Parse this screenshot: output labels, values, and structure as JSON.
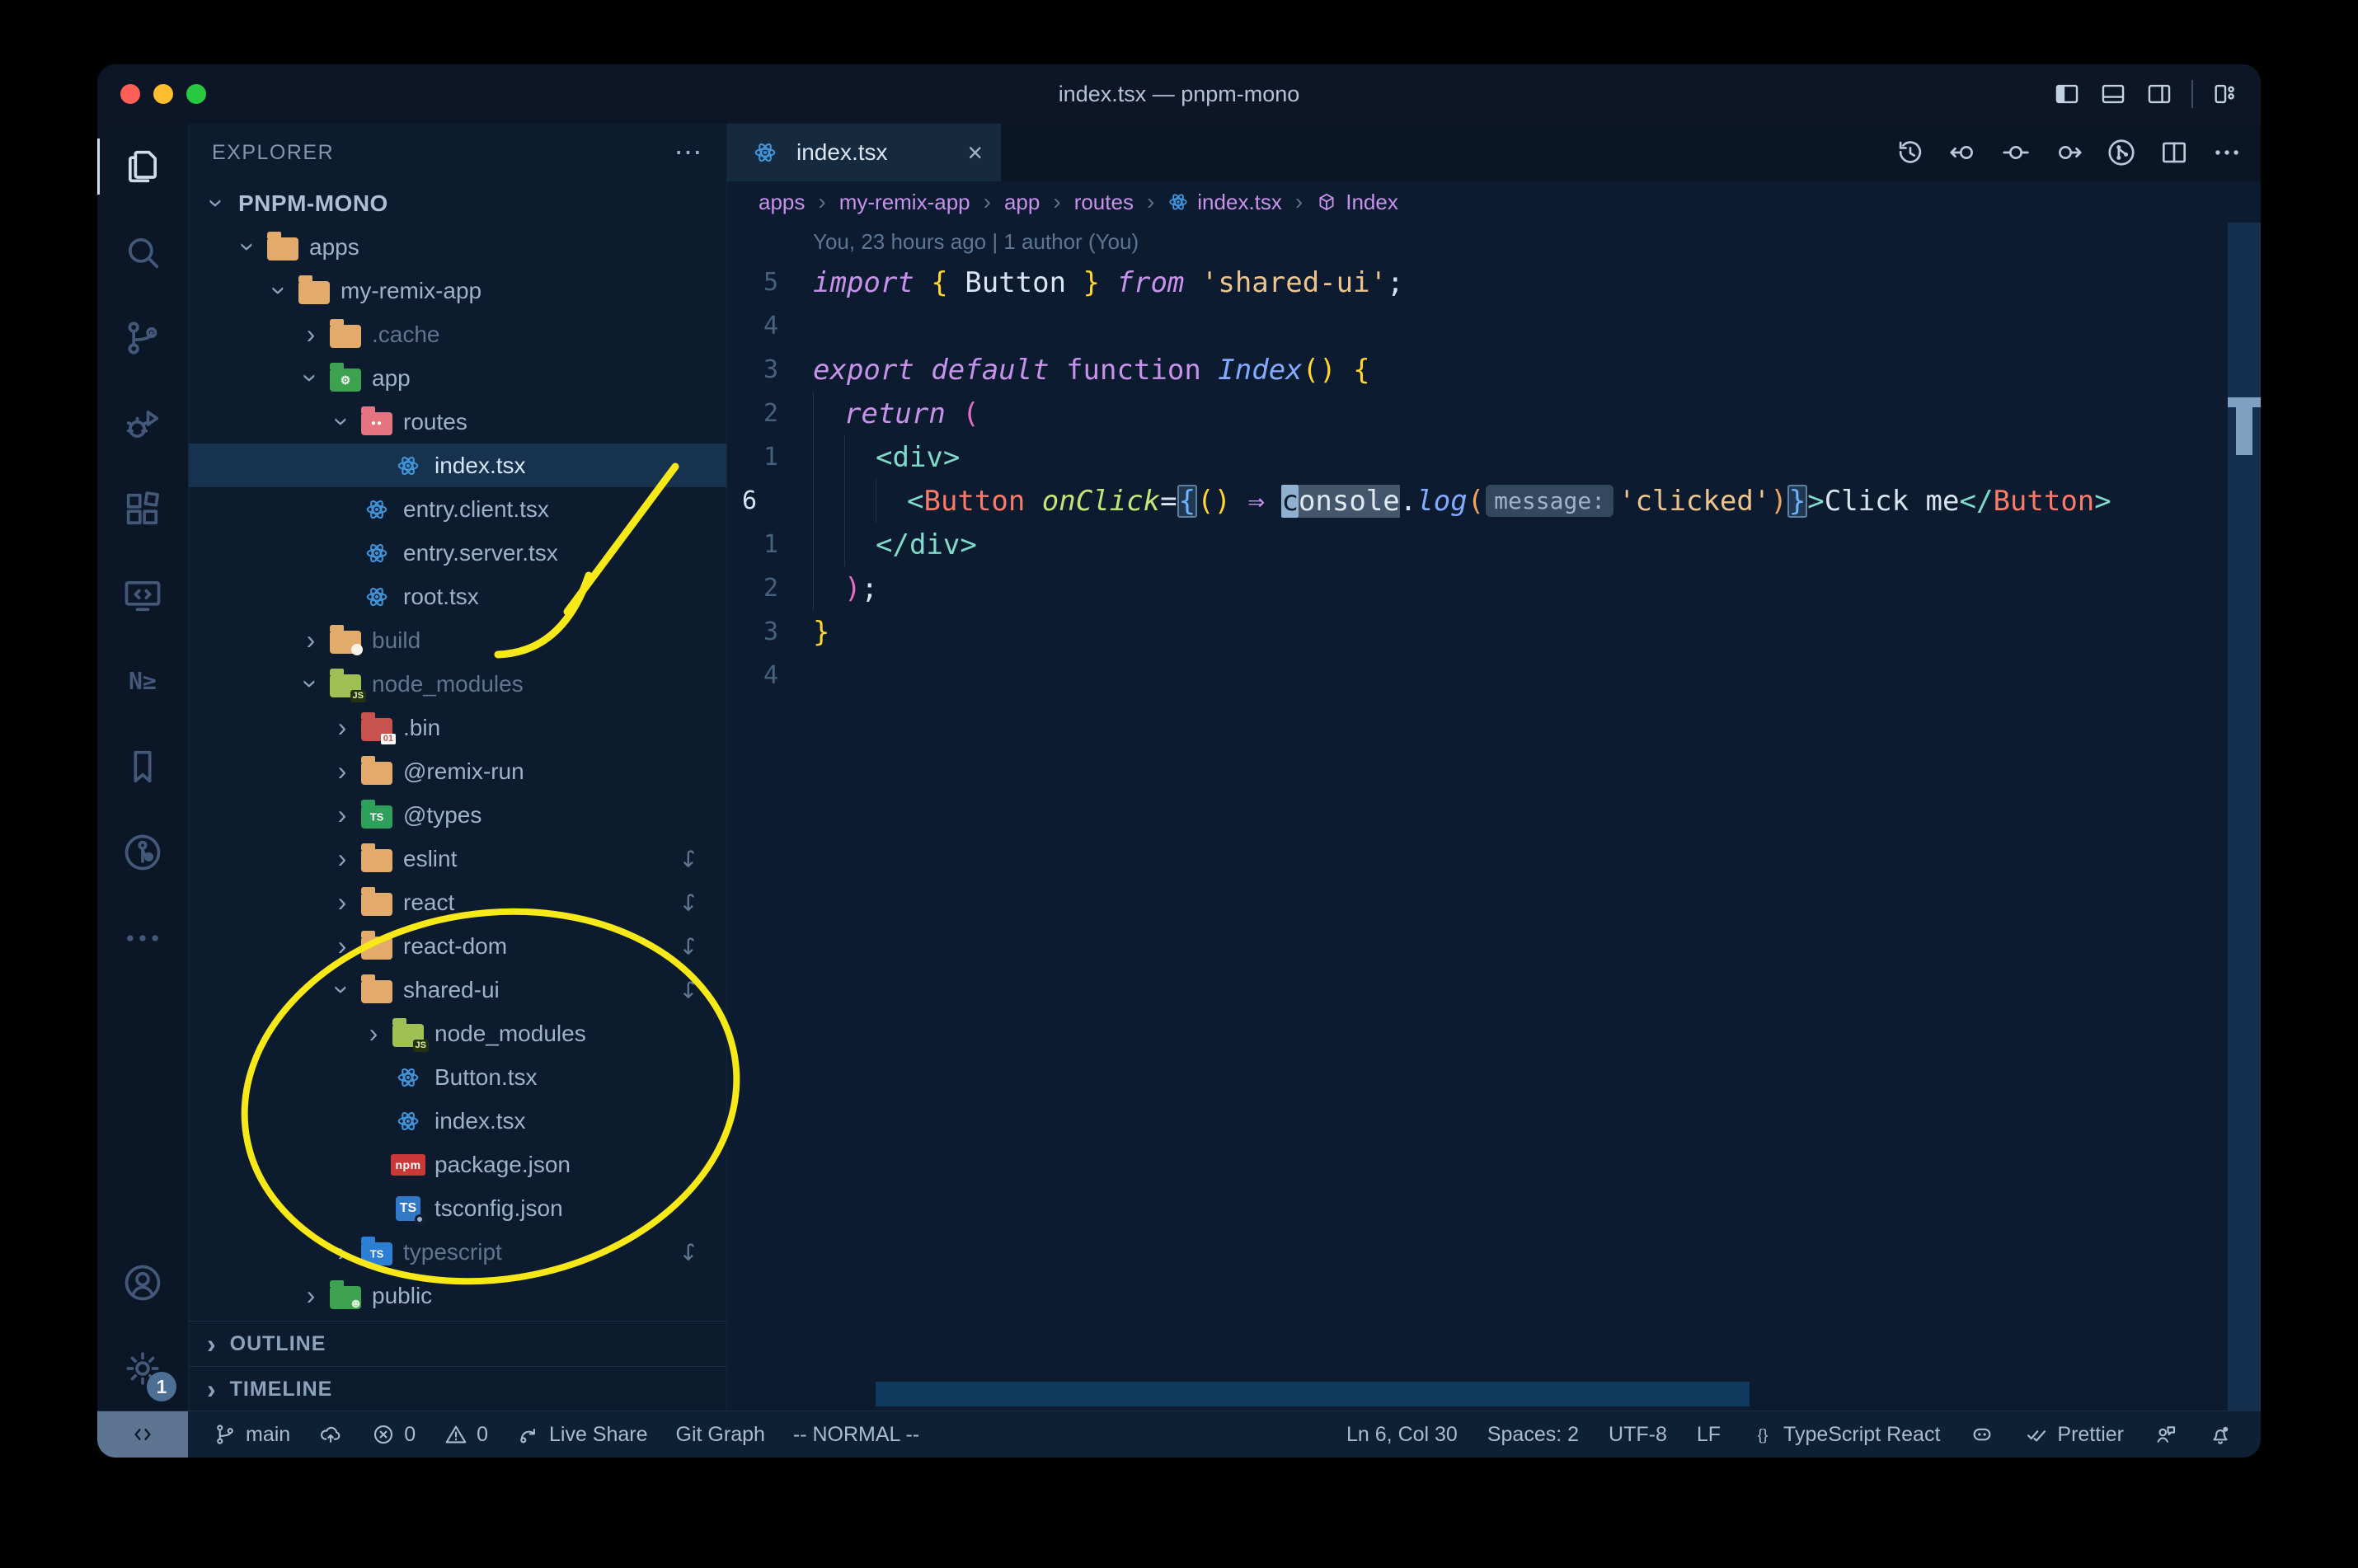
{
  "window": {
    "title": "index.tsx — pnpm-mono"
  },
  "titlebar_icons": [
    "toggle-primary-sidebar",
    "toggle-panel",
    "toggle-secondary-sidebar",
    "separator",
    "customize-layout"
  ],
  "activity_bar": {
    "top": [
      {
        "name": "explorer",
        "icon": "files-icon",
        "active": true
      },
      {
        "name": "search",
        "icon": "search-icon"
      },
      {
        "name": "source-control",
        "icon": "source-control-icon"
      },
      {
        "name": "run-debug",
        "icon": "debug-icon"
      },
      {
        "name": "extensions",
        "icon": "extensions-icon"
      },
      {
        "name": "remote-explorer",
        "icon": "remote-explorer-icon"
      },
      {
        "name": "nx-console",
        "icon": "nx-icon"
      },
      {
        "name": "bookmarks",
        "icon": "bookmark-icon"
      },
      {
        "name": "gitlens",
        "icon": "gitlens-icon"
      },
      {
        "name": "more-views",
        "icon": "more-icon"
      }
    ],
    "bottom": [
      {
        "name": "accounts",
        "icon": "account-icon"
      },
      {
        "name": "settings",
        "icon": "gear-icon",
        "badge": "1"
      }
    ]
  },
  "explorer": {
    "header": "EXPLORER",
    "menu": "⋯",
    "root_label": "PNPM-MONO",
    "items": [
      {
        "label": "apps",
        "icon": "folder-tan",
        "level": 1,
        "chev": "open"
      },
      {
        "label": "my-remix-app",
        "icon": "folder-tan",
        "level": 2,
        "chev": "open"
      },
      {
        "label": ".cache",
        "icon": "folder-tan",
        "level": 3,
        "chev": "closed",
        "dim": true
      },
      {
        "label": "app",
        "icon": "folder-app",
        "level": 3,
        "chev": "open"
      },
      {
        "label": "routes",
        "icon": "folder-routes",
        "level": 4,
        "chev": "open"
      },
      {
        "label": "index.tsx",
        "icon": "react",
        "level": 5,
        "selected": true
      },
      {
        "label": "entry.client.tsx",
        "icon": "react",
        "level": 4
      },
      {
        "label": "entry.server.tsx",
        "icon": "react",
        "level": 4
      },
      {
        "label": "root.tsx",
        "icon": "react",
        "level": 4
      },
      {
        "label": "build",
        "icon": "folder-build",
        "level": 3,
        "chev": "closed",
        "dim": true
      },
      {
        "label": "node_modules",
        "icon": "folder-nm",
        "level": 3,
        "chev": "open",
        "dim": true
      },
      {
        "label": ".bin",
        "icon": "folder-bin",
        "level": 4,
        "chev": "closed"
      },
      {
        "label": "@remix-run",
        "icon": "folder-tan",
        "level": 4,
        "chev": "closed"
      },
      {
        "label": "@types",
        "icon": "folder-types",
        "level": 4,
        "chev": "closed"
      },
      {
        "label": "eslint",
        "icon": "folder-tan",
        "level": 4,
        "chev": "closed",
        "symlink": true
      },
      {
        "label": "react",
        "icon": "folder-tan",
        "level": 4,
        "chev": "closed",
        "symlink": true
      },
      {
        "label": "react-dom",
        "icon": "folder-tan",
        "level": 4,
        "chev": "closed",
        "symlink": true
      },
      {
        "label": "shared-ui",
        "icon": "folder-tan",
        "level": 4,
        "chev": "open",
        "symlink": true
      },
      {
        "label": "node_modules",
        "icon": "folder-nm",
        "level": 5,
        "chev": "closed"
      },
      {
        "label": "Button.tsx",
        "icon": "react",
        "level": 5
      },
      {
        "label": "index.tsx",
        "icon": "react",
        "level": 5
      },
      {
        "label": "package.json",
        "icon": "npm",
        "level": 5
      },
      {
        "label": "tsconfig.json",
        "icon": "ts-gear",
        "level": 5
      },
      {
        "label": "typescript",
        "icon": "folder-ts",
        "level": 4,
        "chev": "closed",
        "dim": true,
        "symlink": true
      },
      {
        "label": "public",
        "icon": "folder-public",
        "level": 3,
        "chev": "closed"
      }
    ],
    "sections": [
      {
        "label": "OUTLINE"
      },
      {
        "label": "TIMELINE"
      }
    ]
  },
  "editor": {
    "tab": {
      "icon": "react",
      "label": "index.tsx",
      "close": "×"
    },
    "actions": [
      "file-history-icon",
      "navigate-back-icon",
      "current-change-icon",
      "navigate-forward-icon",
      "gitlens-graph-icon",
      "split-editor-icon",
      "more-actions-icon"
    ],
    "breadcrumbs": [
      {
        "label": "apps"
      },
      {
        "label": "my-remix-app"
      },
      {
        "label": "app"
      },
      {
        "label": "routes"
      },
      {
        "label": "index.tsx",
        "icon": "react"
      },
      {
        "label": "Index",
        "icon": "symbol-module"
      }
    ],
    "blame": "You, 23 hours ago | 1 author (You)",
    "lines": [
      {
        "n": "5",
        "ind": 0,
        "t": [
          [
            "import ",
            "kw"
          ],
          [
            "{",
            "brace"
          ],
          [
            " Button ",
            "plain"
          ],
          [
            "}",
            "brace"
          ],
          [
            " ",
            "plain"
          ],
          [
            "from",
            "kw"
          ],
          [
            " ",
            "plain"
          ],
          [
            "'shared-ui'",
            "str"
          ],
          [
            ";",
            "plain"
          ]
        ]
      },
      {
        "n": "4",
        "ind": 0,
        "t": []
      },
      {
        "n": "3",
        "ind": 0,
        "t": [
          [
            "export ",
            "kw"
          ],
          [
            "default ",
            "kw"
          ],
          [
            "function ",
            "kw2"
          ],
          [
            "Index",
            "fn"
          ],
          [
            "()",
            "brace"
          ],
          [
            " ",
            "plain"
          ],
          [
            "{",
            "brace"
          ]
        ]
      },
      {
        "n": "2",
        "ind": 1,
        "t": [
          [
            "return ",
            "kw"
          ],
          [
            "(",
            "pink"
          ]
        ]
      },
      {
        "n": "1",
        "ind": 2,
        "t": [
          [
            "<div>",
            "teal"
          ]
        ]
      },
      {
        "n": "6",
        "cur": true,
        "ind": 3,
        "t": [
          [
            "<",
            "teal"
          ],
          [
            "Button",
            "tag"
          ],
          [
            " ",
            "plain"
          ],
          [
            "onClick",
            "attr"
          ],
          [
            "=",
            "plain"
          ],
          [
            "{",
            "blue match"
          ],
          [
            "()",
            "brace"
          ],
          [
            " ",
            "plain"
          ],
          [
            "⇒",
            "purple"
          ],
          [
            " ",
            "plain"
          ],
          [
            "c",
            "cursor"
          ],
          [
            "onsole",
            "sel"
          ],
          [
            ".",
            "plain"
          ],
          [
            "log",
            "fn"
          ],
          [
            "(",
            "orange"
          ],
          [
            "message:",
            "inlay"
          ],
          [
            "'clicked'",
            "str"
          ],
          [
            ")",
            "orange"
          ],
          [
            "}",
            "blue match"
          ],
          [
            ">",
            "teal"
          ],
          [
            "Click me",
            "plain"
          ],
          [
            "</",
            "teal"
          ],
          [
            "Button",
            "tag"
          ],
          [
            ">",
            "teal"
          ]
        ]
      },
      {
        "n": "1",
        "ind": 2,
        "t": [
          [
            "</div>",
            "teal"
          ]
        ]
      },
      {
        "n": "2",
        "ind": 1,
        "t": [
          [
            ")",
            "pink"
          ],
          [
            ";",
            "plain"
          ]
        ]
      },
      {
        "n": "3",
        "ind": 0,
        "t": [
          [
            "}",
            "brace"
          ]
        ]
      },
      {
        "n": "4",
        "ind": 0,
        "t": []
      }
    ]
  },
  "status_bar": {
    "remote_glyph": "remote-indicator-icon",
    "left": [
      {
        "icon": "branch-icon",
        "label": "main"
      },
      {
        "icon": "cloud-upload-icon",
        "label": ""
      },
      {
        "icon": "error-icon",
        "label": "0"
      },
      {
        "icon": "warning-icon",
        "label": "0"
      },
      {
        "icon": "live-share-icon",
        "label": "Live Share"
      },
      {
        "icon": "",
        "label": "Git Graph"
      },
      {
        "icon": "",
        "label": "-- NORMAL --"
      }
    ],
    "right": [
      {
        "icon": "",
        "label": "Ln 6, Col 30"
      },
      {
        "icon": "",
        "label": "Spaces: 2"
      },
      {
        "icon": "",
        "label": "UTF-8"
      },
      {
        "icon": "",
        "label": "LF"
      },
      {
        "icon": "braces-icon",
        "label": "TypeScript React"
      },
      {
        "icon": "copilot-icon",
        "label": ""
      },
      {
        "icon": "prettier-check-icon",
        "label": "Prettier"
      },
      {
        "icon": "feedback-icon",
        "label": ""
      },
      {
        "icon": "bell-icon",
        "label": ""
      }
    ]
  },
  "annotations": {
    "color": "#f7e918",
    "items": [
      {
        "type": "arrow",
        "target": "node_modules folder"
      },
      {
        "type": "ellipse",
        "target": "shared-ui subtree"
      }
    ]
  }
}
